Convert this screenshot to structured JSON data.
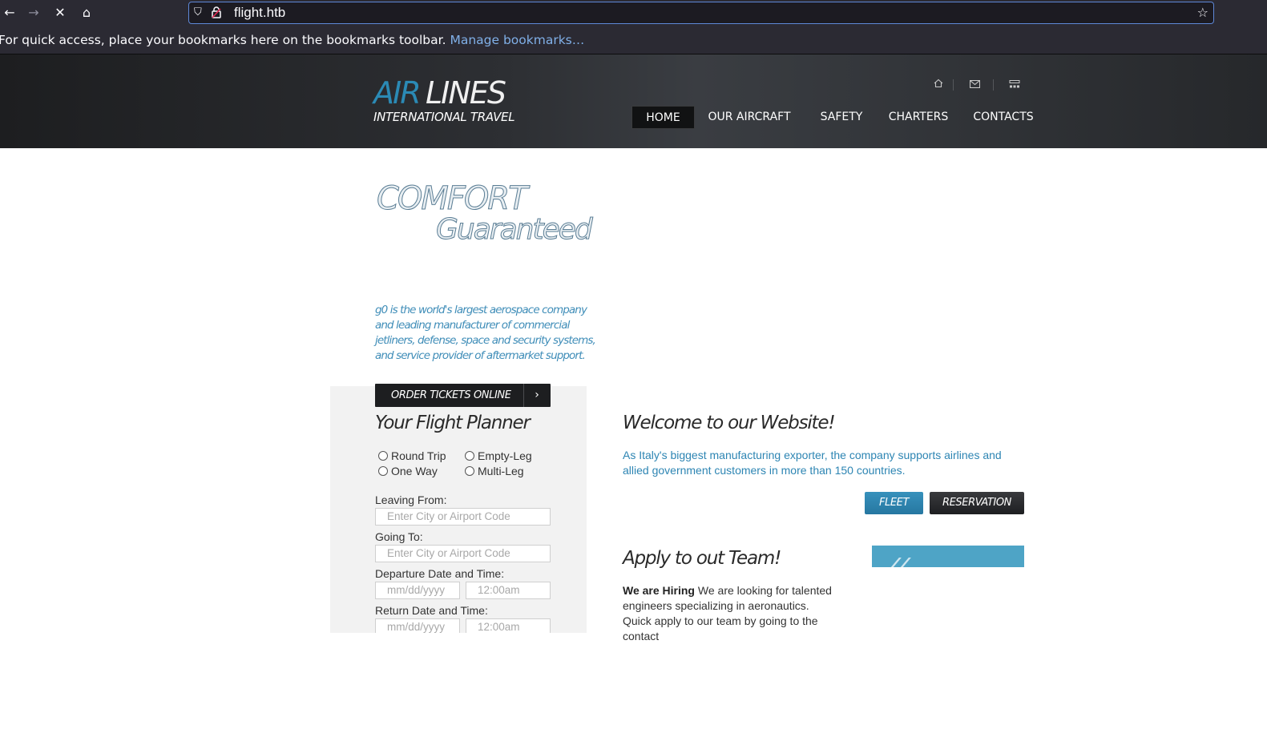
{
  "browser": {
    "url": "flight.htb",
    "bookmarks_message": "For quick access, place your bookmarks here on the bookmarks toolbar.",
    "bookmarks_link": "Manage bookmarks…",
    "icons": [
      "back-arrow-icon",
      "forward-arrow-icon",
      "stop-icon",
      "home-icon",
      "shield-icon",
      "lock-icon",
      "star-icon"
    ]
  },
  "header": {
    "logo_air": "AIR",
    "logo_lines": "LINES",
    "logo_sub": "INTERNATIONAL TRAVEL",
    "mini_icons": [
      "home-icon",
      "mail-icon",
      "sitemap-icon"
    ],
    "nav": [
      {
        "label": "HOME",
        "active": true
      },
      {
        "label": "OUR AIRCRAFT",
        "active": false
      },
      {
        "label": "SAFETY",
        "active": false
      },
      {
        "label": "CHARTERS",
        "active": false
      },
      {
        "label": "CONTACTS",
        "active": false
      }
    ]
  },
  "hero": {
    "line1": "COMFORT",
    "line2": "Guaranteed",
    "text": "g0 is the world's largest aerospace company and leading manufacturer of commercial jetliners, defense, space and security systems, and service provider of aftermarket support."
  },
  "planner": {
    "order_button": "ORDER TICKETS ONLINE",
    "title": "Your Flight Planner",
    "trip_types": [
      "Round Trip",
      "Empty-Leg",
      "One Way",
      "Multi-Leg"
    ],
    "leaving_label": "Leaving From:",
    "leaving_placeholder": "Enter City or Airport Code",
    "going_label": "Going To:",
    "going_placeholder": "Enter City or Airport Code",
    "departure_label": "Departure Date and Time:",
    "return_label": "Return Date and Time:",
    "date_placeholder": "mm/dd/yyyy",
    "time_placeholder": "12:00am"
  },
  "welcome": {
    "title": "Welcome to our Website!",
    "text": "As Italy's biggest manufacturing exporter, the company supports airlines and allied government customers in more than 150 countries.",
    "fleet_button": "FLEET",
    "reservation_button": "RESERVATION"
  },
  "apply": {
    "title": "Apply to out Team!",
    "hiring_bold": "We are Hiring",
    "text": "We are looking for talented engineers specializing in aeronautics. Quick apply to our team by going to the contact"
  },
  "colors": {
    "accent_blue": "#2b8ab5",
    "header_dark": "#2d2f33",
    "browser_chrome": "#2b2a33"
  }
}
